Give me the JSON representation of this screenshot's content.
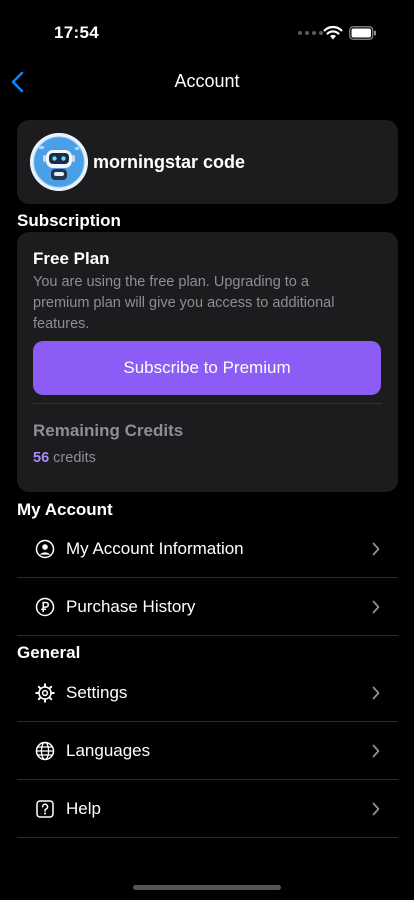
{
  "status": {
    "time": "17:54"
  },
  "nav": {
    "title": "Account"
  },
  "profile": {
    "name": "morningstar code"
  },
  "subscription": {
    "header": "Subscription",
    "plan_title": "Free Plan",
    "plan_desc": "You are using the free plan. Upgrading to a premium plan will give you access to additional features.",
    "subscribe_label": "Subscribe to Premium",
    "credits_label": "Remaining Credits",
    "credits_value": "56",
    "credits_unit": "credits"
  },
  "my_account": {
    "header": "My Account",
    "items": [
      {
        "label": "My Account Information",
        "icon": "person-circle-icon"
      },
      {
        "label": "Purchase History",
        "icon": "coin-icon"
      }
    ]
  },
  "general": {
    "header": "General",
    "items": [
      {
        "label": "Settings",
        "icon": "gear-icon"
      },
      {
        "label": "Languages",
        "icon": "globe-icon"
      },
      {
        "label": "Help",
        "icon": "question-icon"
      }
    ]
  },
  "colors": {
    "accent": "#8b5cf6",
    "credits": "#a78bfa",
    "card": "#1c1c1e",
    "back": "#0a84ff"
  }
}
